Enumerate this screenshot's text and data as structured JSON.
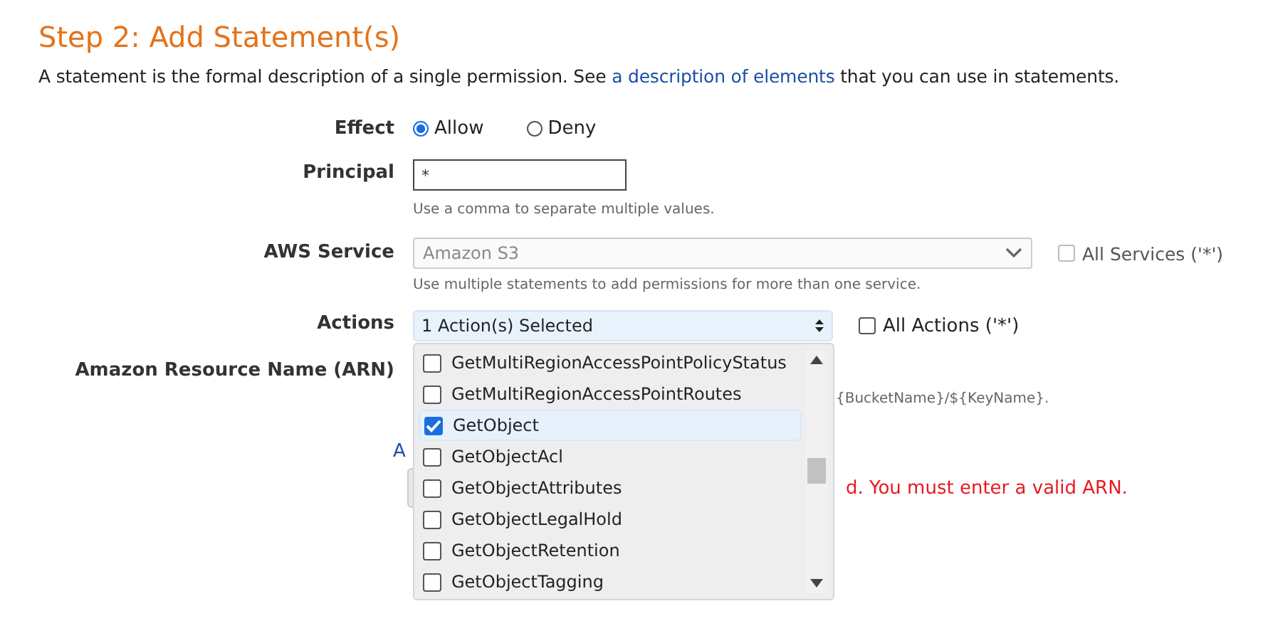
{
  "heading": "Step 2: Add Statement(s)",
  "intro": {
    "before": "A statement is the formal description of a single permission. See ",
    "link": "a description of elements",
    "after": " that you can use in statements."
  },
  "effect": {
    "label": "Effect",
    "options": [
      {
        "label": "Allow",
        "selected": true
      },
      {
        "label": "Deny",
        "selected": false
      }
    ]
  },
  "principal": {
    "label": "Principal",
    "value": "*",
    "hint": "Use a comma to separate multiple values."
  },
  "aws_service": {
    "label": "AWS Service",
    "value": "Amazon S3",
    "disabled": true,
    "all_label": "All Services ('*')",
    "all_checked": false,
    "all_disabled": true,
    "hint": "Use multiple statements to add permissions for more than one service."
  },
  "actions": {
    "label": "Actions",
    "value": "1 Action(s) Selected",
    "all_label": "All Actions ('*')",
    "all_checked": false,
    "expanded": true,
    "items": [
      {
        "label": "GetMultiRegionAccessPointPolicyStatus",
        "checked": false
      },
      {
        "label": "GetMultiRegionAccessPointRoutes",
        "checked": false
      },
      {
        "label": "GetObject",
        "checked": true
      },
      {
        "label": "GetObjectAcl",
        "checked": false
      },
      {
        "label": "GetObjectAttributes",
        "checked": false
      },
      {
        "label": "GetObjectLegalHold",
        "checked": false
      },
      {
        "label": "GetObjectRetention",
        "checked": false
      },
      {
        "label": "GetObjectTagging",
        "checked": false
      }
    ]
  },
  "arn": {
    "label": "Amazon Resource Name (ARN)",
    "hint_fragment": "{BucketName}/${KeyName}.",
    "link_fragment": "A",
    "error_fragment": "d. You must enter a valid ARN."
  }
}
